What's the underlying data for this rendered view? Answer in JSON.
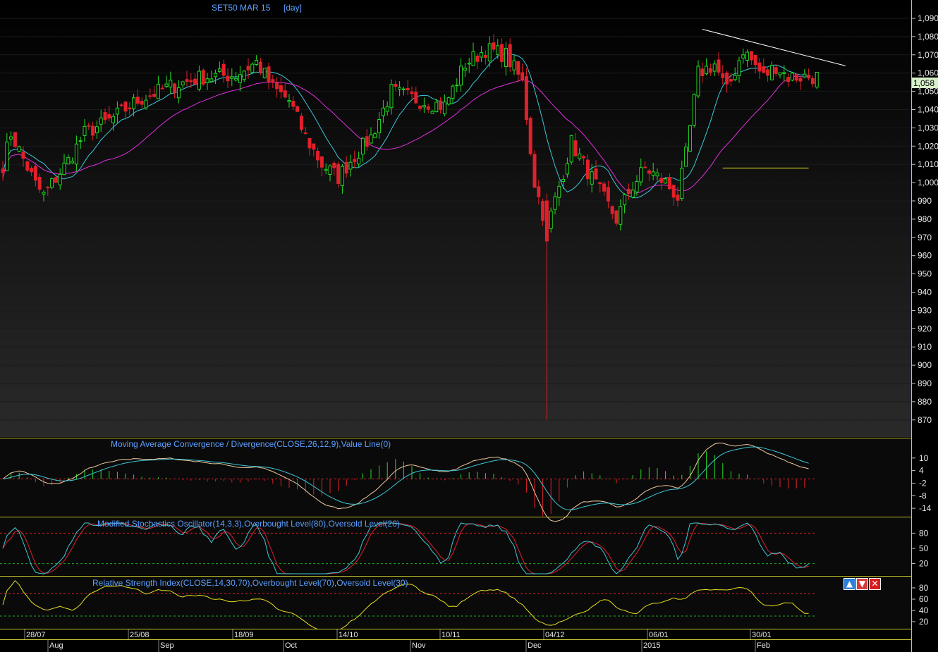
{
  "chart_data": {
    "type": "candlestick",
    "title": "SET50 MAR 15",
    "period_label": "[day]",
    "last_price_label": "1,058",
    "price_axis_ticks": [
      "1,090",
      "1,080",
      "1,070",
      "1,060",
      "1,050",
      "1,040",
      "1,030",
      "1,020",
      "1,010",
      "1,000",
      "990",
      "980",
      "970",
      "960",
      "950",
      "940",
      "930",
      "920",
      "910",
      "900",
      "890",
      "880",
      "870"
    ],
    "ylim": [
      863,
      1092
    ],
    "colors": {
      "up": "#22dd22",
      "down": "#e0202a",
      "ma_fast": "#3cc8d8",
      "ma_slow": "#e030e0",
      "ma_long": "#e8e020",
      "trendline": "#ffffff"
    },
    "x_date_labels": [
      "28/07",
      "25/08",
      "18/09",
      "14/10",
      "10/11",
      "04/12",
      "06/01",
      "30/01"
    ],
    "x_month_labels": [
      "Aug",
      "Sep",
      "Oct",
      "Nov",
      "Dec",
      "2015",
      "Feb"
    ],
    "anchors": [
      {
        "i": 0,
        "p": 1010
      },
      {
        "i": 2,
        "p": 1027
      },
      {
        "i": 8,
        "p": 999
      },
      {
        "i": 10,
        "p": 993
      },
      {
        "i": 16,
        "p": 1012
      },
      {
        "i": 20,
        "p": 1027
      },
      {
        "i": 26,
        "p": 1034
      },
      {
        "i": 33,
        "p": 1045
      },
      {
        "i": 40,
        "p": 1052
      },
      {
        "i": 49,
        "p": 1058
      },
      {
        "i": 57,
        "p": 1059
      },
      {
        "i": 62,
        "p": 1066
      },
      {
        "i": 66,
        "p": 1052
      },
      {
        "i": 70,
        "p": 1045
      },
      {
        "i": 74,
        "p": 1025
      },
      {
        "i": 78,
        "p": 1010
      },
      {
        "i": 82,
        "p": 1003
      },
      {
        "i": 85,
        "p": 1012
      },
      {
        "i": 90,
        "p": 1025
      },
      {
        "i": 95,
        "p": 1050
      },
      {
        "i": 102,
        "p": 1045
      },
      {
        "i": 108,
        "p": 1042
      },
      {
        "i": 113,
        "p": 1065
      },
      {
        "i": 118,
        "p": 1073
      },
      {
        "i": 123,
        "p": 1070
      },
      {
        "i": 127,
        "p": 1055
      },
      {
        "i": 130,
        "p": 1000
      },
      {
        "i": 133,
        "p": 975
      },
      {
        "i": 136,
        "p": 998
      },
      {
        "i": 139,
        "p": 1022
      },
      {
        "i": 142,
        "p": 1010
      },
      {
        "i": 146,
        "p": 995
      },
      {
        "i": 150,
        "p": 980
      },
      {
        "i": 153,
        "p": 995
      },
      {
        "i": 157,
        "p": 1008
      },
      {
        "i": 162,
        "p": 1000
      },
      {
        "i": 165,
        "p": 992
      },
      {
        "i": 167,
        "p": 1015
      },
      {
        "i": 170,
        "p": 1060
      },
      {
        "i": 174,
        "p": 1065
      },
      {
        "i": 177,
        "p": 1050
      },
      {
        "i": 181,
        "p": 1073
      },
      {
        "i": 186,
        "p": 1058
      },
      {
        "i": 189,
        "p": 1064
      },
      {
        "i": 192,
        "p": 1058
      }
    ],
    "crash_candle": {
      "i": 133,
      "open": 990,
      "close": 968,
      "low": 870,
      "high": 994
    },
    "trendline": [
      {
        "i": 171,
        "p": 1084
      },
      {
        "i": 206,
        "p": 1064
      }
    ],
    "panels": [
      {
        "label": "Moving Average Convergence / Divergence(CLOSE,26,12,9),Value Line(0)",
        "ticks": [
          "10",
          "4",
          "-2",
          "-8",
          "-14"
        ],
        "range": [
          -17,
          16
        ]
      },
      {
        "label": "Modified Stochastics Oscillator(14,3,3),Overbought Level(80),Oversold Level(20)",
        "ticks": [
          "80",
          "50",
          "20"
        ],
        "range": [
          0,
          100
        ]
      },
      {
        "label": "Relative Strength Index(CLOSE,14,30,70),Overbought Level(70),Oversold Level(30)",
        "ticks": [
          "80",
          "60",
          "40",
          "20"
        ],
        "range": [
          10,
          90
        ]
      }
    ]
  },
  "toolbar": {
    "up_icon": "▲",
    "down_icon": "▼",
    "close_icon": "✕"
  }
}
